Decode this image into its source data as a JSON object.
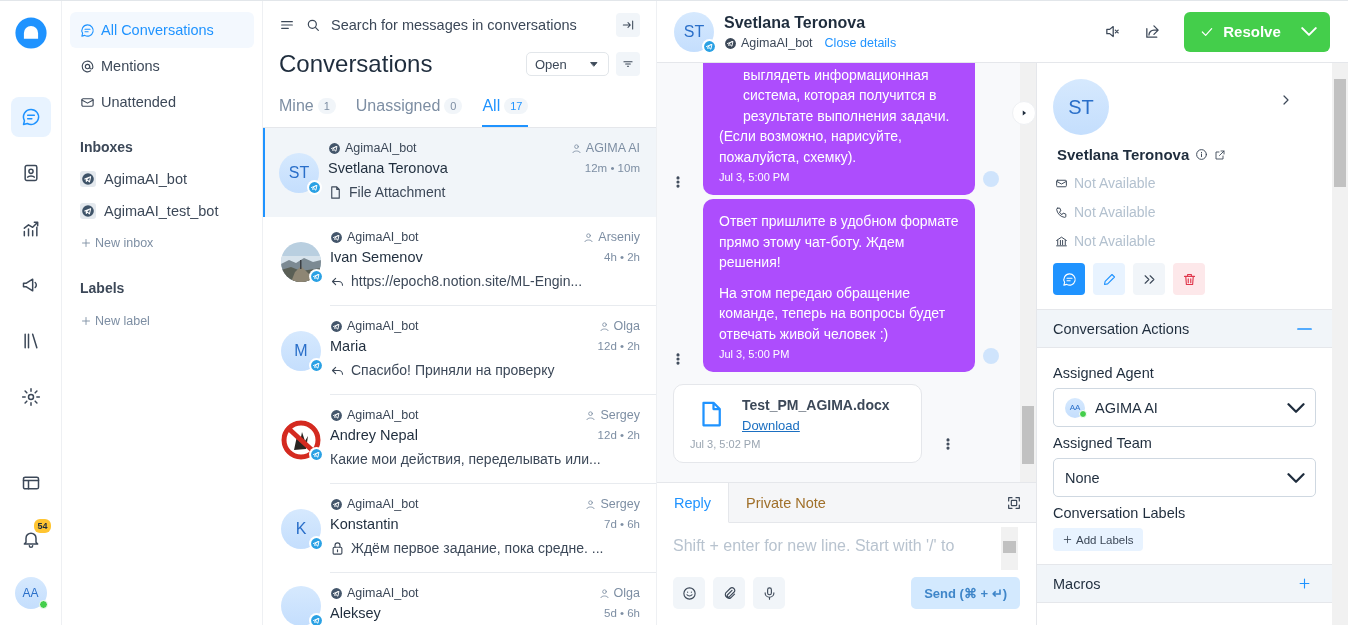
{
  "rail_items": [
    {
      "kind": "conversations",
      "selected": true
    },
    {
      "kind": "contacts",
      "selected": false
    },
    {
      "kind": "reports",
      "selected": false
    },
    {
      "kind": "campaigns",
      "selected": false
    },
    {
      "kind": "library",
      "selected": false
    },
    {
      "kind": "settings",
      "selected": false
    }
  ],
  "rail_bottom": {
    "notifications_badge": "54",
    "user": {
      "initials": "AA",
      "online": true
    }
  },
  "sidebar": {
    "items": [
      {
        "label": "All Conversations",
        "kind": "all",
        "selected": true
      },
      {
        "label": "Mentions",
        "kind": "mentions",
        "selected": false
      },
      {
        "label": "Unattended",
        "kind": "unattended",
        "selected": false
      }
    ],
    "inboxes_title": "Inboxes",
    "inboxes": [
      {
        "label": "AgimaAI_bot"
      },
      {
        "label": "AgimaAI_test_bot"
      }
    ],
    "new_inbox": "New inbox",
    "labels_title": "Labels",
    "new_label": "New label"
  },
  "conversation_list": {
    "search_placeholder": "Search for messages in conversations",
    "title": "Conversations",
    "status_filter": "Open",
    "tabs": [
      {
        "label": "Mine",
        "count": "1",
        "selected": false
      },
      {
        "label": "Unassigned",
        "count": "0",
        "selected": false
      },
      {
        "label": "All",
        "count": "17",
        "selected": true
      }
    ],
    "conversations": [
      {
        "inbox": "AgimaAI_bot",
        "assignee": "AGIMA AI",
        "name": "Svetlana Teronova",
        "times": "12m • 10m",
        "preview": {
          "kind": "attachment",
          "text": "File Attachment"
        },
        "avatar": {
          "kind": "initials",
          "initials": "ST"
        },
        "selected": true
      },
      {
        "inbox": "AgimaAI_bot",
        "assignee": "Arseniy",
        "name": "Ivan Semenov",
        "times": "4h • 2h",
        "preview": {
          "kind": "reply",
          "text": "https://epoch8.notion.site/ML-Engin..."
        },
        "selected": false
      },
      {
        "inbox": "AgimaAI_bot",
        "assignee": "Olga",
        "name": "Maria",
        "times": "12d • 2h",
        "preview": {
          "kind": "reply",
          "text": "Спасибо! Приняли на проверку"
        },
        "avatar": {
          "kind": "initials",
          "initials": "M"
        },
        "selected": false
      },
      {
        "inbox": "AgimaAI_bot",
        "assignee": "Sergey",
        "name": "Andrey Nepal",
        "times": "12d • 2h",
        "preview": {
          "kind": "plain",
          "text": "Какие мои действия, переделывать или..."
        },
        "avatar": {
          "kind": "sign"
        },
        "selected": false
      },
      {
        "inbox": "AgimaAI_bot",
        "assignee": "Sergey",
        "name": "Konstantin",
        "times": "7d • 6h",
        "preview": {
          "kind": "private",
          "text": "Ждём первое задание, пока средне. ..."
        },
        "avatar": {
          "kind": "initials",
          "initials": "K"
        },
        "selected": false
      },
      {
        "inbox": "AgimaAI_bot",
        "assignee": "Olga",
        "name": "Aleksey",
        "times": "5d • 6h",
        "avatar": {
          "kind": "blank"
        },
        "selected": false
      }
    ]
  },
  "chat": {
    "contact": {
      "initials": "ST",
      "name": "Svetlana Teronova",
      "inbox": "AgimaAI_bot",
      "close_details": "Close details"
    },
    "resolve": "Resolve",
    "messages": [
      {
        "kind": "outgoing",
        "blocks": [
          {
            "kind": "list_tail",
            "text": "выглядеть информационная система, которая получится в результате выполнения задачи."
          },
          {
            "kind": "paragraph",
            "text": "(Если возможно, нарисуйте, пожалуйста, схемку)."
          }
        ],
        "time": "Jul 3, 5:00 PM"
      },
      {
        "kind": "outgoing",
        "blocks": [
          {
            "kind": "paragraph",
            "text": "Ответ пришлите в удобном формате прямо этому чат-боту. Ждем решения!"
          },
          {
            "kind": "paragraph",
            "text": "На этом передаю обращение команде, теперь на вопросы будет отвечать живой человек :)"
          }
        ],
        "time": "Jul 3, 5:00 PM"
      },
      {
        "kind": "attachment",
        "file": "Test_PM_AGIMA.docx",
        "link": "Download",
        "time": "Jul 3, 5:02 PM"
      }
    ],
    "reply": {
      "tabs": [
        {
          "label": "Reply",
          "kind": "reply",
          "selected": true
        },
        {
          "label": "Private Note",
          "kind": "note",
          "selected": false
        }
      ],
      "placeholder": "Shift + enter for new line. Start with '/' to",
      "send": "Send (⌘ + ↵)",
      "send_disabled": true
    }
  },
  "details": {
    "initials": "ST",
    "name": "Svetlana Teronova",
    "contacts": [
      {
        "kind": "email",
        "value": "Not Available"
      },
      {
        "kind": "phone",
        "value": "Not Available"
      },
      {
        "kind": "company",
        "value": "Not Available"
      }
    ],
    "actions": [
      {
        "kind": "message"
      },
      {
        "kind": "edit"
      },
      {
        "kind": "merge"
      },
      {
        "kind": "delete"
      }
    ],
    "conversation_actions": {
      "title": "Conversation Actions",
      "expanded": true,
      "agent_label": "Assigned Agent",
      "agent": {
        "initials": "AA",
        "name": "AGIMA AI",
        "online": true
      },
      "team_label": "Assigned Team",
      "team": "None",
      "labels_label": "Conversation Labels",
      "add_labels": "Add Labels"
    },
    "macros": {
      "title": "Macros",
      "expanded": false
    }
  }
}
